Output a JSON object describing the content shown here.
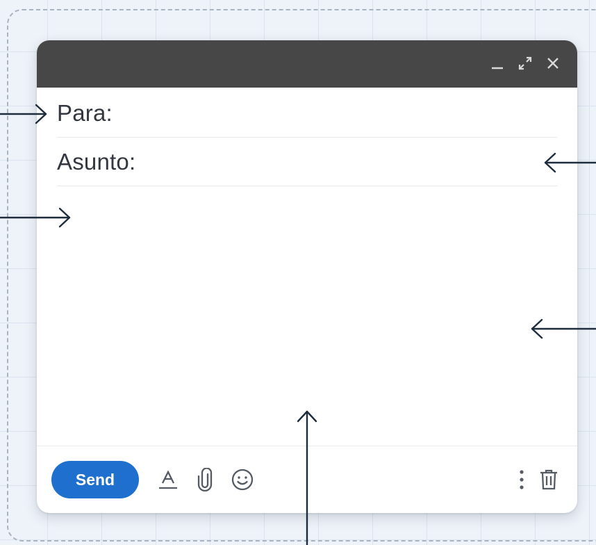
{
  "compose": {
    "to_label": "Para:",
    "to_value": "",
    "subject_label": "Asunto:",
    "subject_value": "",
    "body_value": "",
    "send_label": "Send"
  },
  "colors": {
    "titlebar": "#474747",
    "send": "#1f6fcf",
    "arrow": "#1e2d3d"
  },
  "icons": [
    "minimize-icon",
    "expand-icon",
    "close-icon",
    "text-format-icon",
    "attach-icon",
    "emoji-icon",
    "more-options-icon",
    "trash-icon"
  ]
}
